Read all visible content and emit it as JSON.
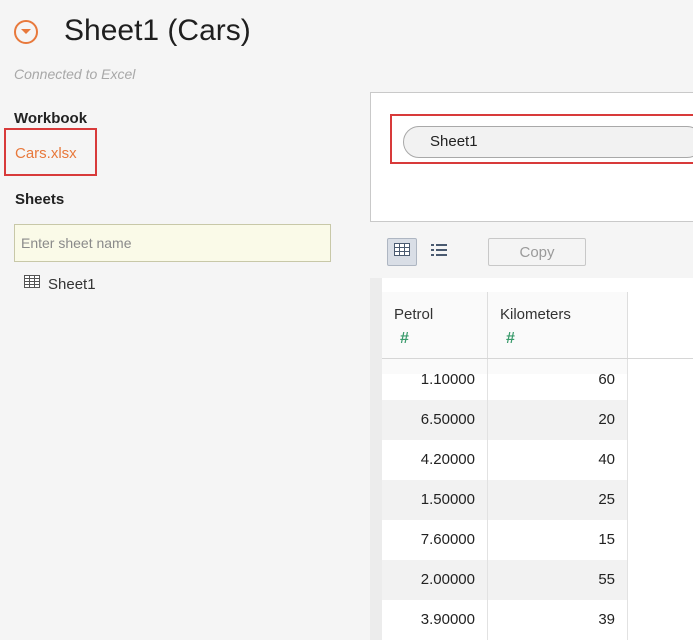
{
  "header": {
    "title": "Sheet1 (Cars)",
    "connection_status": "Connected to Excel",
    "icon": "chevron-down-circle-icon",
    "accent_color": "#e8793c"
  },
  "sidebar": {
    "workbook_heading": "Workbook",
    "workbook_file": "Cars.xlsx",
    "sheets_heading": "Sheets",
    "sheet_search_placeholder": "Enter sheet name",
    "sheet_search_value": "",
    "sheets": [
      {
        "label": "Sheet1",
        "icon": "table-icon"
      }
    ]
  },
  "canvas": {
    "table_pill": "Sheet1",
    "highlight_color": "#d83a3a"
  },
  "toolbar": {
    "grid_view_icon": "grid-view-icon",
    "list_view_icon": "list-view-icon",
    "copy_label": "Copy"
  },
  "data_grid": {
    "columns": [
      {
        "name": "Petrol",
        "type_symbol": "#"
      },
      {
        "name": "Kilometers",
        "type_symbol": "#"
      }
    ],
    "rows": [
      [
        "1.10000",
        "60"
      ],
      [
        "6.50000",
        "20"
      ],
      [
        "4.20000",
        "40"
      ],
      [
        "1.50000",
        "25"
      ],
      [
        "7.60000",
        "15"
      ],
      [
        "2.00000",
        "55"
      ],
      [
        "3.90000",
        "39"
      ]
    ]
  }
}
